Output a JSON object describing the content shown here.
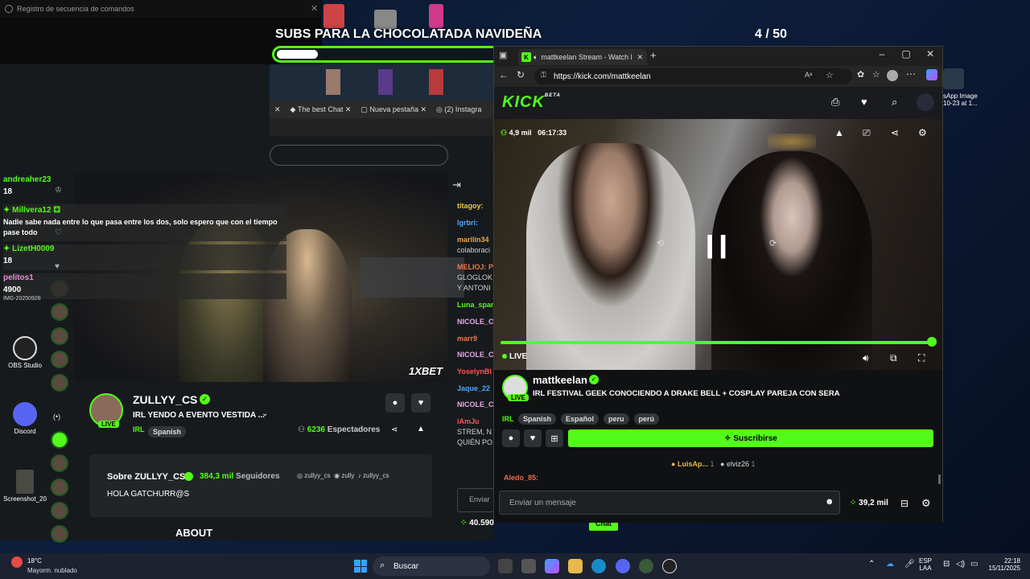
{
  "command_log": {
    "title": "Registro de secuencia de comandos"
  },
  "overlay": {
    "title": "SUBS PARA LA CHOCOLATADA NAVIDEÑA",
    "counter": "4  / 50",
    "goal_progress": 0.08
  },
  "bg_browser": {
    "tabs": [
      "The best Chat",
      "Nueva pestaña",
      "(2) Instagra"
    ]
  },
  "left_chat": [
    {
      "name": "andreaher23",
      "text": "18"
    },
    {
      "name": "Millvera12",
      "text": "Nadie sabe nada entre lo que pasa entre los dos, solo espero que con el tiempo pase todo"
    },
    {
      "name": "LizetH0009",
      "text": "18"
    },
    {
      "name": "pelitos1",
      "text": "4900"
    }
  ],
  "zully": {
    "brand_logo": "1XBET",
    "name": "ZULLYY_CS",
    "live": "LIVE",
    "title": "IRL YENDO A EVENTO VESTIDA ...",
    "category": "IRL",
    "tag": "Spanish",
    "viewers": "6236",
    "viewers_label": "Espectadores",
    "about_title": "Sobre ZULLYY_CS",
    "followers": "384,3 mil",
    "followers_label": "Seguidores",
    "socials": [
      "zullyy_cs",
      "zully",
      "zullyy_cs"
    ],
    "about_text": "HOLA GATCHURR@S",
    "about_heading": "ABOUT",
    "live_icon": "(•)"
  },
  "zully_chat": [
    {
      "name": "titagoy:",
      "color": "#e8c84a"
    },
    {
      "name": "lgrbri:",
      "color": "#53a6fc"
    },
    {
      "name": "marilin34",
      "color": "#e8a84a"
    },
    {
      "name": "colaboraci",
      "color": "#cfcfcf"
    },
    {
      "name": "MELIOJ: P",
      "color": "#e87a4a"
    },
    {
      "name": "GLOGLOK",
      "color": "#cfcfcf"
    },
    {
      "name": "Y ANTONI",
      "color": "#cfcfcf"
    },
    {
      "name": "Luna_spar",
      "color": "#53fc18"
    },
    {
      "name": "NICOLE_C",
      "color": "#e8a8e8"
    },
    {
      "name": "marr9",
      "color": "#e87a4a"
    },
    {
      "name": "NICOLE_C",
      "color": "#e8a8e8"
    },
    {
      "name": "YoselynBl",
      "color": "#fc5353"
    },
    {
      "name": "Jaque_22",
      "color": "#53a6fc"
    },
    {
      "name": "NICOLE_C",
      "color": "#e8a8e8"
    },
    {
      "name": "iAmJu",
      "color": "#fc5353"
    },
    {
      "name": "STREM, N",
      "color": "#cfcfcf"
    },
    {
      "name": "QUIÉN PO",
      "color": "#cfcfcf"
    }
  ],
  "zully_chat_input": {
    "placeholder": "Enviar",
    "points": "40.590",
    "send": "Chat"
  },
  "window": {
    "tab_title": "mattkeelan Stream - Watch l",
    "url": "https://kick.com/mattkeelan",
    "logo": "KICK",
    "logo_beta": "BETA"
  },
  "video": {
    "viewers": "4,9 mil",
    "uptime": "06:17:33",
    "live": "LIVE",
    "progress": 1.0
  },
  "stream": {
    "streamer": "mattkeelan",
    "live": "LIVE",
    "title": "IRL FESTIVAL GEEK CONOCIENDO A DRAKE BELL + COSPLAY PAREJA CON SERA",
    "category": "IRL",
    "tags": [
      "Spanish",
      "Español",
      "peru",
      "perú"
    ],
    "subscribe": "Suscribirse",
    "gifters": [
      {
        "name": "LuisAp...",
        "count": "1"
      },
      {
        "name": "elviz26",
        "count": "1"
      }
    ],
    "partial_chat": "Aledo_85:",
    "chat_placeholder": "Enviar un mensaje",
    "points": "39,2 mil"
  },
  "desktop": {
    "left_icons": [
      {
        "label": "IMG-20250928"
      },
      {
        "label": "OBS Studio"
      },
      {
        "label": "Discord"
      },
      {
        "label": "Screenshot_20"
      }
    ],
    "right_icon_label": "sApp Image\n10-23 at 1..."
  },
  "taskbar": {
    "weather_temp": "18°C",
    "weather_text": "Mayorm. nublado",
    "search": "Buscar",
    "lang1": "ESP",
    "lang2": "LAA",
    "time": "22:18",
    "date": "15/11/2025"
  },
  "colors": {
    "kick_green": "#53fc18",
    "bg_dark": "#0f1113"
  }
}
